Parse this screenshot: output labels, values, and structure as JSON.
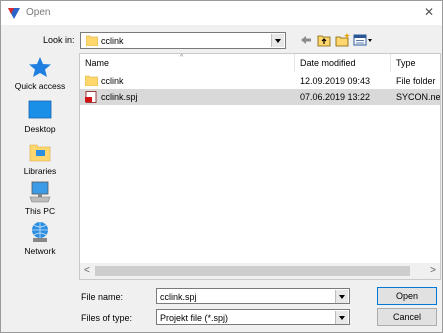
{
  "window": {
    "title": "Open"
  },
  "look_in": {
    "label": "Look in:",
    "value": "cclink"
  },
  "places": [
    {
      "label": "Quick access",
      "icon": "star-icon"
    },
    {
      "label": "Desktop",
      "icon": "desktop-icon"
    },
    {
      "label": "Libraries",
      "icon": "libraries-icon"
    },
    {
      "label": "This PC",
      "icon": "computer-icon"
    },
    {
      "label": "Network",
      "icon": "network-icon"
    }
  ],
  "columns": {
    "name": "Name",
    "date": "Date modified",
    "type": "Type"
  },
  "files": [
    {
      "name": "cclink",
      "date": "12.09.2019 09:43",
      "type": "File folder",
      "icon": "folder-icon"
    },
    {
      "name": "cclink.spj",
      "date": "07.06.2019 13:22",
      "type": "SYCON.ne",
      "icon": "spj-file-icon",
      "selected": true
    }
  ],
  "file_name": {
    "label": "File name:",
    "value": "cclink.spj"
  },
  "file_type": {
    "label": "Files of type:",
    "value": "Projekt file (*.spj)"
  },
  "buttons": {
    "open": "Open",
    "cancel": "Cancel"
  },
  "colors": {
    "selection": "#d9d9d9",
    "accent": "#0078d7",
    "folder": "#ffd76e"
  }
}
